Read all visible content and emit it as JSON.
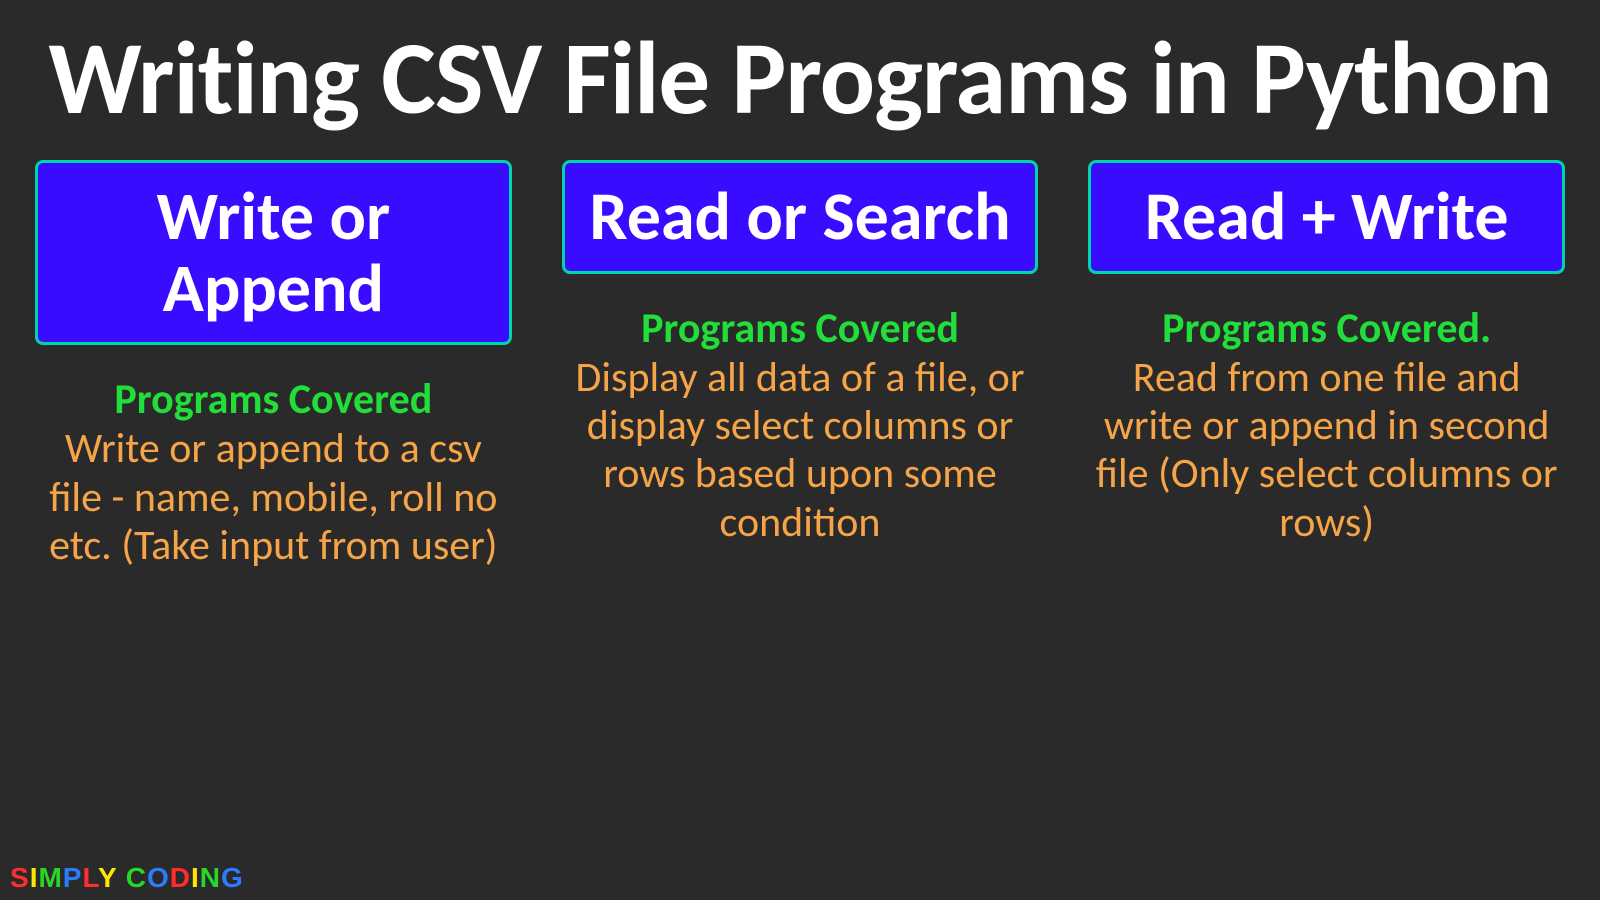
{
  "title": "Writing CSV File Programs in Python",
  "columns": [
    {
      "box_label": "Write or Append",
      "subhead": "Programs Covered",
      "desc": "Write or append to a csv file  - name, mobile, roll no etc. (Take input from user)"
    },
    {
      "box_label": "Read or Search",
      "subhead": "Programs Covered",
      "desc": "Display all data of a file, or display select columns or rows based upon some condition"
    },
    {
      "box_label": "Read + Write",
      "subhead": "Programs Covered.",
      "desc": "Read from one file and write or append in second file (Only select columns or rows)"
    }
  ],
  "logo": "SIMPLY CODING"
}
